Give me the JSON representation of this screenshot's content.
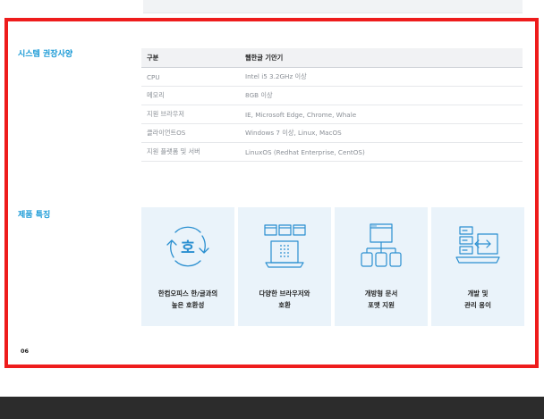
{
  "sections": {
    "system_requirements": "시스템 권장사양",
    "product_features": "제품 특징"
  },
  "spec_table": {
    "headers": [
      "구분",
      "웹한글 기안기"
    ],
    "rows": [
      [
        "CPU",
        "Intel i5 3.2GHz 이상"
      ],
      [
        "메모리",
        "8GB 이상"
      ],
      [
        "지원 브라우저",
        "IE, Microsoft Edge, Chrome, Whale"
      ],
      [
        "클라이언트OS",
        "Windows 7 이상, Linux, MacOS"
      ],
      [
        "지원 플랫폼 및 서버",
        "LinuxOS (Redhat Enterprise, CentOS)"
      ]
    ]
  },
  "features": [
    {
      "icon": "sync-hangul-icon",
      "line1": "한컴오피스 한/글과의",
      "line2": "높은 호환성",
      "glyph": "호"
    },
    {
      "icon": "browser-windows-icon",
      "line1": "다양한 브라우저와",
      "line2": "호환"
    },
    {
      "icon": "document-tree-icon",
      "line1": "개방형 문서",
      "line2": "포맷 지원"
    },
    {
      "icon": "laptop-transfer-icon",
      "line1": "개발 및",
      "line2": "관리 용이"
    }
  ],
  "page_number": "06",
  "colors": {
    "accent": "#1a9ad6",
    "highlight_border": "#ee1c1c",
    "feature_bg": "#eaf3fa",
    "icon_stroke": "#2a8fd0"
  }
}
